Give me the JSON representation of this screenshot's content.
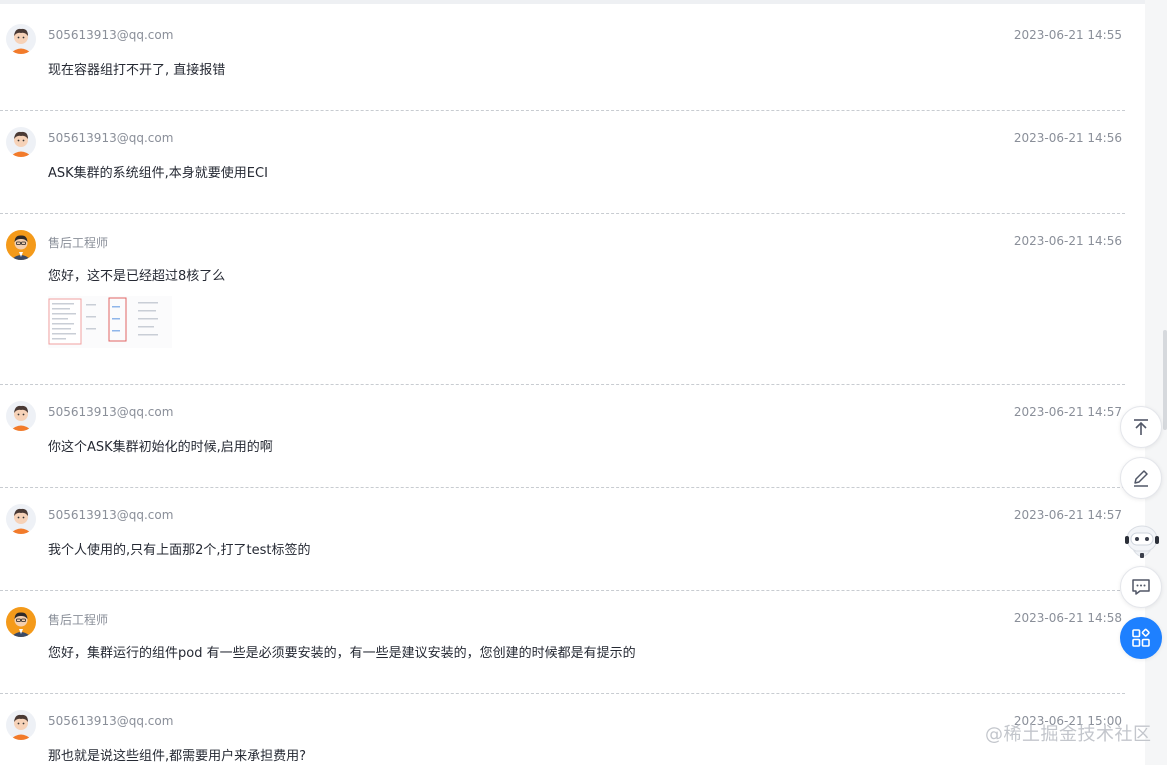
{
  "thread": {
    "messages": [
      {
        "sender": "505613913@qq.com",
        "time": "2023-06-21 14:55",
        "text": "现在容器组打不开了, 直接报错",
        "avatar": "user-avatar"
      },
      {
        "sender": "505613913@qq.com",
        "time": "2023-06-21 14:56",
        "text": "ASK集群的系统组件,本身就要使用ECI",
        "avatar": "user-avatar"
      },
      {
        "sender": "售后工程师",
        "time": "2023-06-21 14:56",
        "text": "您好，这不是已经超过8核了么",
        "avatar": "engineer-avatar",
        "has_image": true
      },
      {
        "sender": "505613913@qq.com",
        "time": "2023-06-21 14:57",
        "text": "你这个ASK集群初始化的时候,启用的啊",
        "avatar": "user-avatar"
      },
      {
        "sender": "505613913@qq.com",
        "time": "2023-06-21 14:57",
        "text": "我个人使用的,只有上面那2个,打了test标签的",
        "avatar": "user-avatar"
      },
      {
        "sender": "售后工程师",
        "time": "2023-06-21 14:58",
        "text": "您好，集群运行的组件pod 有一些是必须要安装的，有一些是建议安装的，您创建的时候都是有提示的",
        "avatar": "engineer-avatar"
      },
      {
        "sender": "505613913@qq.com",
        "time": "2023-06-21 15:00",
        "text": "那也就是说这些组件,都需要用户来承担费用?",
        "avatar": "user-avatar"
      }
    ]
  },
  "sidebar": {
    "buttons": [
      "back-to-top-icon",
      "edit-icon",
      "assistant-robot-icon",
      "comment-icon",
      "apps-grid-icon"
    ]
  },
  "watermark": "@稀土掘金技术社区",
  "colors": {
    "accent": "#1e80ff",
    "meta_text": "#8a8f99",
    "body_text": "#252933",
    "divider": "#c8ccd1"
  }
}
